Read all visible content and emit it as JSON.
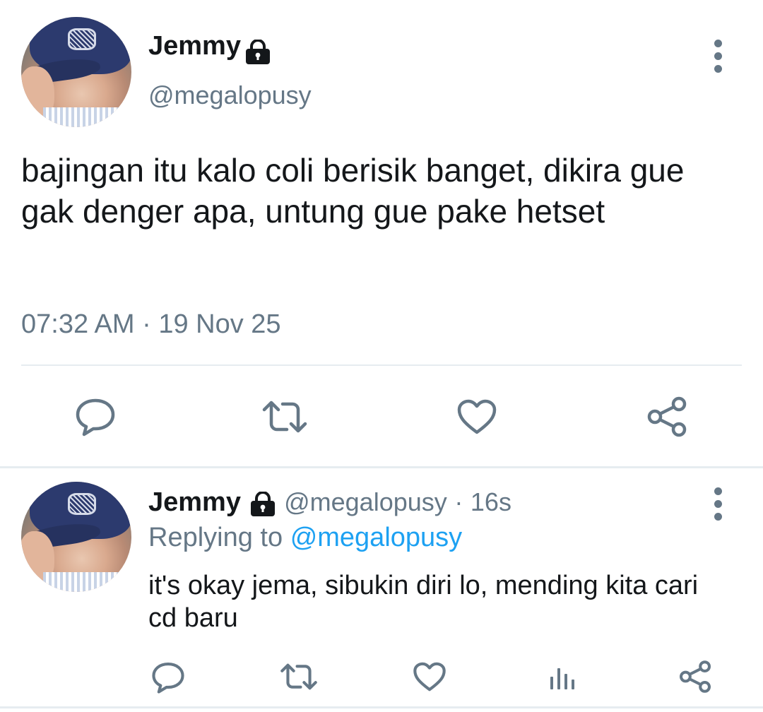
{
  "main_tweet": {
    "author_name": "Jemmy",
    "author_handle": "@megalopusy",
    "text": "bajingan itu kalo coli berisik banget, dikira gue gak denger apa, untung gue pake hetset",
    "timestamp": "07:32 AM · 19 Nov 25",
    "actions": [
      "reply-icon",
      "retweet-icon",
      "like-icon",
      "share-icon"
    ]
  },
  "reply_tweet": {
    "author_name": "Jemmy",
    "author_handle": "@megalopusy",
    "separator": "·",
    "time_ago": "16s",
    "replying_prefix": "Replying to",
    "replying_to": "@megalopusy",
    "text": "it's okay jema, sibukin diri lo, mending kita cari cd baru",
    "actions": [
      "reply-icon",
      "retweet-icon",
      "like-icon",
      "analytics-icon",
      "share-icon"
    ]
  },
  "colors": {
    "text": "#14171a",
    "secondary": "#657786",
    "accent": "#1da1f2",
    "divider": "#e6ecf0"
  }
}
